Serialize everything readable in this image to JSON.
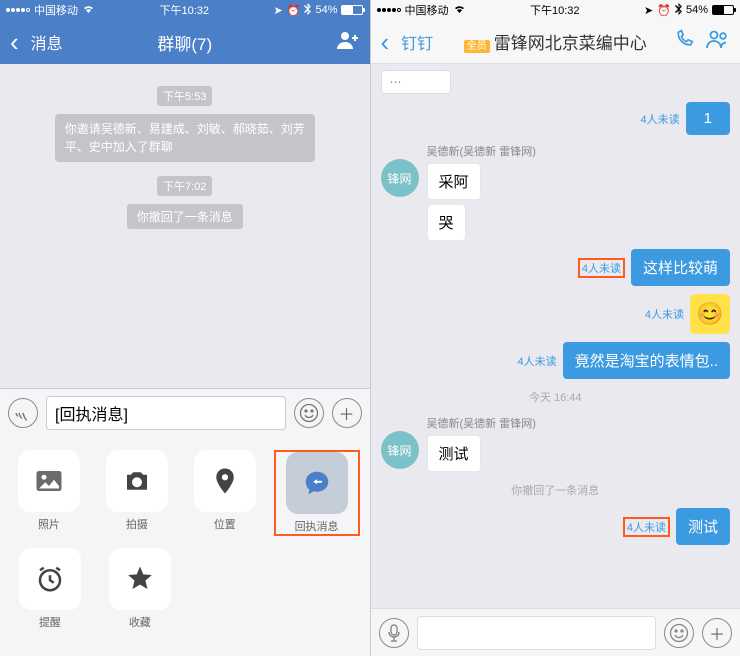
{
  "statusBar": {
    "carrier": "中国移动",
    "time": "下午10:32",
    "batteryText": "54%"
  },
  "left": {
    "nav": {
      "back": "消息",
      "title": "群聊(7)"
    },
    "chat": {
      "ts1": "下午5:53",
      "sys1": "你邀请吴德新、易建成、刘敏、郝晓茹、刘芳平、史中加入了群聊",
      "ts2": "下午7:02",
      "recall": "你撤回了一条消息"
    },
    "input": {
      "text": "[回执消息]"
    },
    "attach": {
      "photo": "照片",
      "camera": "拍摄",
      "location": "位置",
      "receipt": "回执消息",
      "reminder": "提醒",
      "favorite": "收藏"
    }
  },
  "right": {
    "nav": {
      "back": "钉钉",
      "badge": "全员",
      "title": "雷锋网北京菜编中心"
    },
    "chat": {
      "unread": "4人未读",
      "msg_one": "1",
      "sender1": "吴德新(吴德新 雷锋网)",
      "avatar1": "锋网",
      "in1a": "采阿",
      "in1b": "哭",
      "out2": "这样比较萌",
      "out3": "竟然是淘宝的表情包..",
      "ts": "今天 16:44",
      "in2": "测试",
      "recall": "你撤回了一条消息",
      "out4": "测试"
    }
  }
}
